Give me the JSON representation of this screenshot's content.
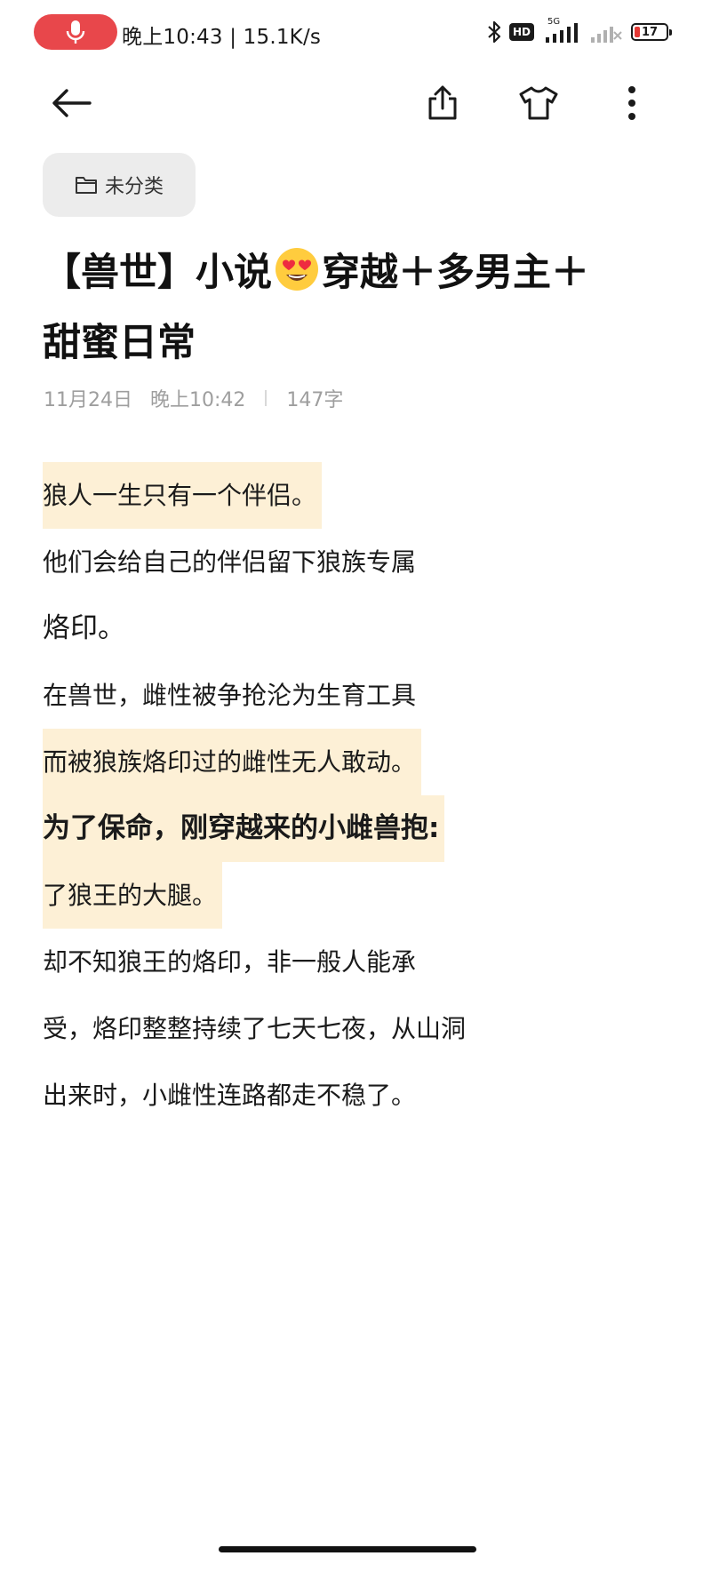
{
  "status_bar": {
    "time_speed": "晚上10:43 | 15.1K/s",
    "network_label": "5G",
    "hd_label": "HD",
    "battery": "17",
    "accent_mic": "#e8474b"
  },
  "toolbar": {
    "icons": [
      "arrow-left-icon",
      "share-icon",
      "tshirt-icon",
      "more-vertical-icon"
    ]
  },
  "note": {
    "category": "未分类",
    "title": {
      "before_emoji": "【兽世】小说",
      "emoji": "heart-eyes-emoji",
      "after_emoji": "穿越＋多男主＋",
      "line2": "甜蜜日常"
    },
    "date": "11月24日",
    "time": "晚上10:42",
    "word_count": "147字",
    "paragraphs": [
      "狼人一生只有一个伴侣。",
      "他们会给自己的伴侣留下狼族专属",
      "烙印。",
      "在兽世，雌性被争抢沦为生育工具",
      "而被狼族烙印过的雌性无人敢动。",
      "为了保命，刚穿越来的小雌兽抱:",
      "了狼王的大腿。",
      "却不知狼王的烙印，非一般人能承",
      "受，烙印整整持续了七天七夜，从山洞",
      "出来时，小雌性连路都走不稳了。"
    ],
    "highlight_color": "#fdf0d6"
  }
}
